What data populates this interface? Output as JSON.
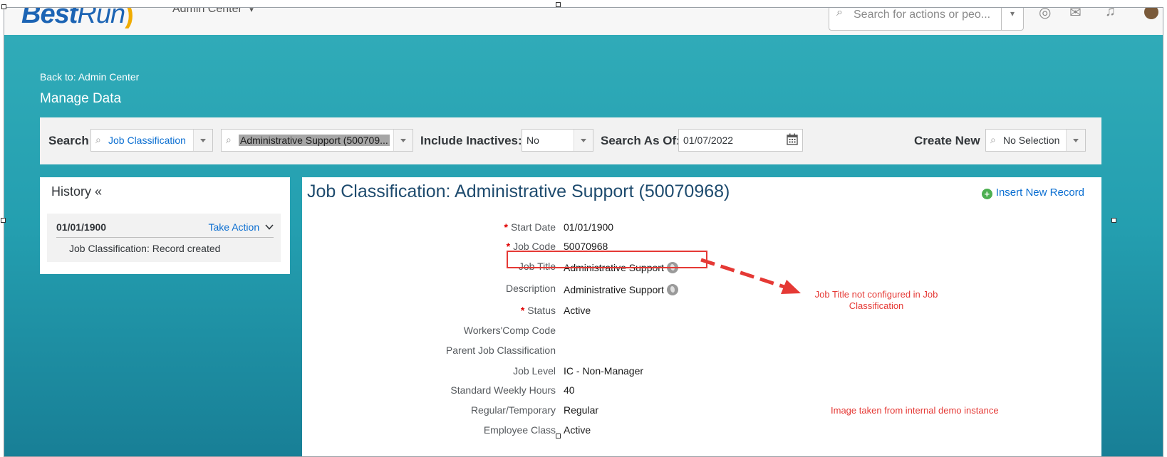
{
  "shell": {
    "logo_best": "Best",
    "logo_run": "Run",
    "module_title": "Admin Center",
    "search_placeholder": "Search for actions or peo..."
  },
  "nav": {
    "back_link": "Back to: Admin Center",
    "page_title": "Manage Data"
  },
  "search_bar": {
    "search_label": "Search",
    "object_type": "Job Classification",
    "record": "Administrative Support (500709...",
    "include_inactives_label": "Include Inactives:",
    "include_inactives_value": "No",
    "search_as_of_label": "Search As Of:",
    "search_as_of_value": "01/07/2022",
    "create_new_label": "Create New",
    "create_new_value": "No Selection"
  },
  "history": {
    "title": "History «",
    "entries": [
      {
        "date": "01/01/1900",
        "action": "Take Action",
        "description": "Job Classification: Record created"
      }
    ]
  },
  "detail": {
    "title": "Job Classification: Administrative Support (50070968)",
    "insert_label": "Insert New Record",
    "fields": [
      {
        "label": "Start Date",
        "value": "01/01/1900",
        "required": "*"
      },
      {
        "label": "Job Code",
        "value": "50070968",
        "required": "*"
      },
      {
        "label": "Job Title",
        "value": "Administrative Support",
        "required": ""
      },
      {
        "label": "Description",
        "value": "Administrative Support",
        "required": ""
      },
      {
        "label": "Status",
        "value": "Active",
        "required": "*"
      },
      {
        "label": "Workers'Comp Code",
        "value": "",
        "required": ""
      },
      {
        "label": "Parent Job Classification",
        "value": "",
        "required": ""
      },
      {
        "label": "Job Level",
        "value": "IC - Non-Manager",
        "required": ""
      },
      {
        "label": "Standard Weekly Hours",
        "value": "40",
        "required": ""
      },
      {
        "label": "Regular/Temporary",
        "value": "Regular",
        "required": ""
      },
      {
        "label": "Employee Class",
        "value": "Active",
        "required": ""
      }
    ]
  },
  "annotations": {
    "note_line1": "Job Title not configured in Job",
    "note_line2": "Classification",
    "source_note": "Image taken from internal demo instance"
  },
  "colors": {
    "teal": "#249fb0",
    "link_blue": "#0a6ed1",
    "title_blue": "#1e4b6e",
    "annotation_red": "#e53935"
  }
}
